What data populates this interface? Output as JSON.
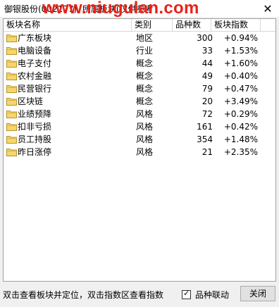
{
  "window": {
    "title": "御银股份(002177)",
    "title_tail": "所属板块(仅供参考",
    "watermark": "www.niugulan.com",
    "close_glyph": "✕"
  },
  "table": {
    "columns": [
      "板块名称",
      "类别",
      "品种数",
      "板块指数"
    ],
    "rows": [
      {
        "name": "广东板块",
        "category": "地区",
        "count": "300",
        "index": "+0.94%"
      },
      {
        "name": "电脑设备",
        "category": "行业",
        "count": "33",
        "index": "+1.53%"
      },
      {
        "name": "电子支付",
        "category": "概念",
        "count": "44",
        "index": "+1.60%"
      },
      {
        "name": "农村金融",
        "category": "概念",
        "count": "49",
        "index": "+0.40%"
      },
      {
        "name": "民营银行",
        "category": "概念",
        "count": "79",
        "index": "+0.47%"
      },
      {
        "name": "区块链",
        "category": "概念",
        "count": "20",
        "index": "+3.49%"
      },
      {
        "name": "业绩预降",
        "category": "风格",
        "count": "72",
        "index": "+0.29%"
      },
      {
        "name": "扣非亏损",
        "category": "风格",
        "count": "161",
        "index": "+0.42%"
      },
      {
        "name": "员工持股",
        "category": "风格",
        "count": "354",
        "index": "+1.48%"
      },
      {
        "name": "昨日涨停",
        "category": "风格",
        "count": "21",
        "index": "+2.35%"
      }
    ]
  },
  "footer": {
    "hint": "双击查看板块并定位，双击指数区查看指数",
    "linkage_label": "品种联动",
    "linkage_checked": true,
    "close_label": "关闭"
  },
  "icons": {
    "row_icon": "folder-icon",
    "folder_color": "#f5d66b"
  }
}
